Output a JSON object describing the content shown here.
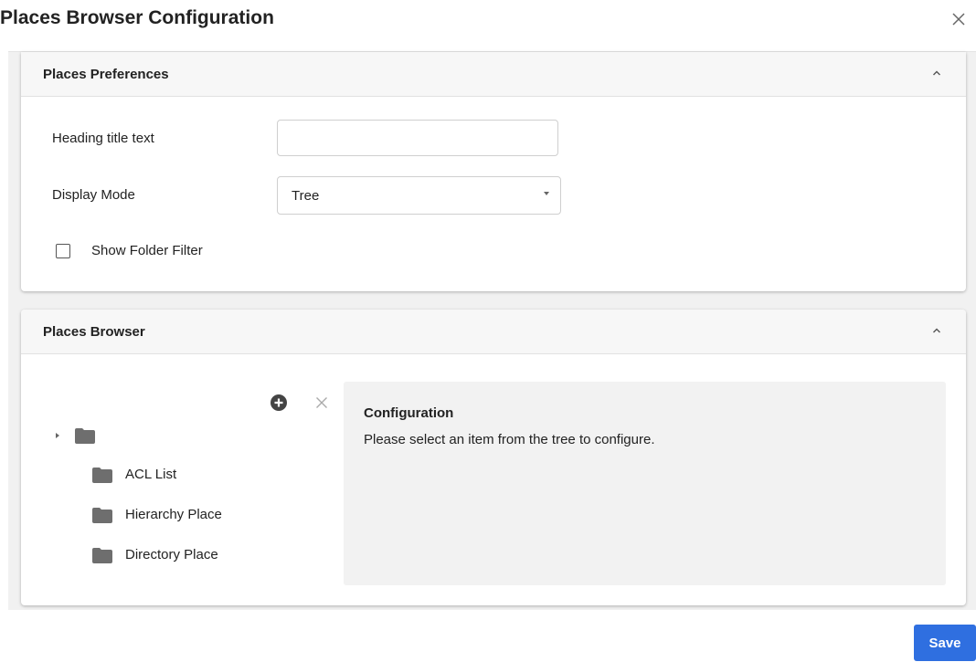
{
  "dialog": {
    "title": "Places Browser Configuration",
    "close_icon": "close-icon"
  },
  "preferences_panel": {
    "title": "Places Preferences",
    "collapse_icon": "chevron-up-icon",
    "heading_label": "Heading title text",
    "heading_value": "",
    "display_mode_label": "Display Mode",
    "display_mode_value": "Tree",
    "show_folder_filter_label": "Show Folder Filter",
    "show_folder_filter_checked": false
  },
  "browser_panel": {
    "title": "Places Browser",
    "collapse_icon": "chevron-up-icon",
    "toolbar": {
      "add_icon": "plus-circle-icon",
      "remove_icon": "close-icon"
    },
    "tree": {
      "root_label": "",
      "items": [
        {
          "label": "ACL List",
          "icon": "folder-icon"
        },
        {
          "label": "Hierarchy Place",
          "icon": "folder-icon"
        },
        {
          "label": "Directory Place",
          "icon": "folder-icon"
        }
      ]
    },
    "config": {
      "title": "Configuration",
      "message": "Please select an item from the tree to configure."
    }
  },
  "footer": {
    "save_label": "Save"
  },
  "colors": {
    "primary": "#2f6fe0",
    "panel_header_bg": "#f7f7f7",
    "body_bg": "#f1f1f1",
    "config_bg": "#f2f2f2",
    "folder": "#6e6e6e"
  }
}
